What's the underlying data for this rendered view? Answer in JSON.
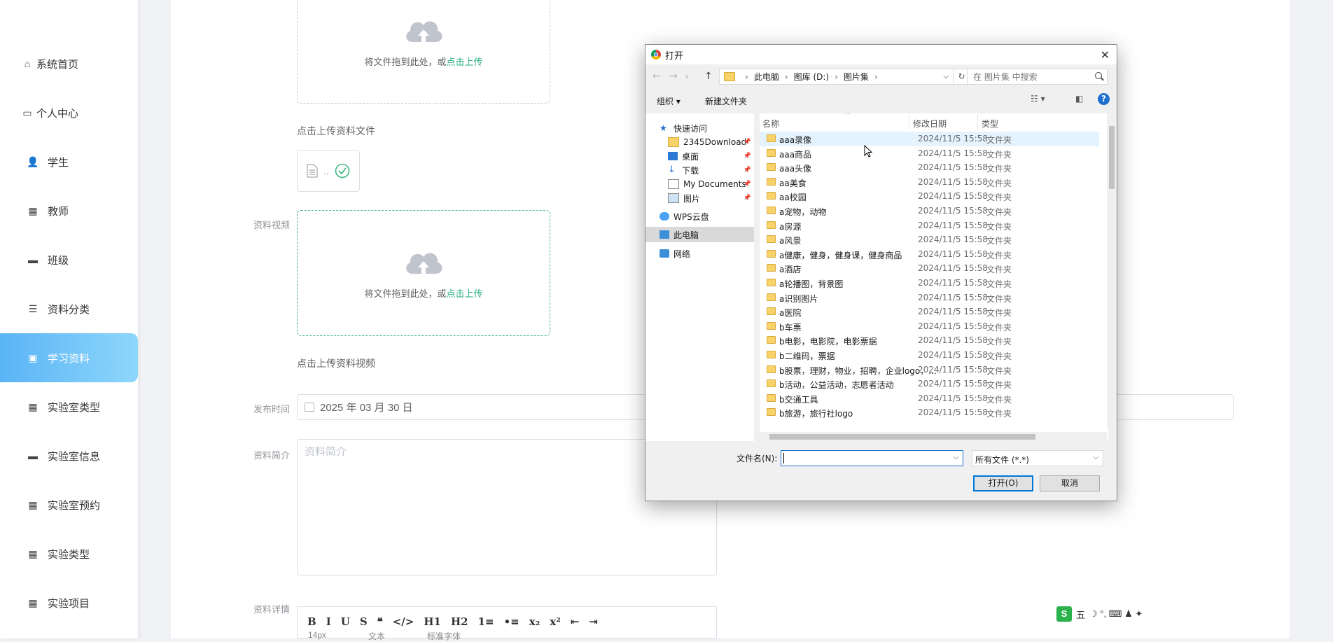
{
  "sidebar": {
    "items": [
      {
        "label": "系统首页",
        "icon": "home-icon"
      },
      {
        "label": "个人中心",
        "icon": "id-card-icon"
      },
      {
        "label": "学生",
        "icon": "user-icon"
      },
      {
        "label": "教师",
        "icon": "grid-icon"
      },
      {
        "label": "班级",
        "icon": "briefcase-icon"
      },
      {
        "label": "资料分类",
        "icon": "list-icon"
      },
      {
        "label": "学习资料",
        "icon": "clipboard-icon",
        "active": true
      },
      {
        "label": "实验室类型",
        "icon": "grid-icon"
      },
      {
        "label": "实验室信息",
        "icon": "monitor-icon"
      },
      {
        "label": "实验室预约",
        "icon": "grid-icon"
      },
      {
        "label": "实验类型",
        "icon": "grid-icon"
      },
      {
        "label": "实验项目",
        "icon": "grid-icon"
      }
    ]
  },
  "form": {
    "upload_drag_text": "将文件拖到此处，或",
    "upload_link": "点击上传",
    "file_tip": "点击上传资料文件",
    "file_thumb_text": "..",
    "video_label": "资料视频",
    "video_tip": "点击上传资料视频",
    "date_label": "发布时间",
    "date_value": "2025 年 03 月 30 日",
    "intro_label": "资料简介",
    "intro_placeholder": "资料简介",
    "detail_label": "资料详情",
    "editor_buttons": [
      "B",
      "I",
      "U",
      "S",
      "❝",
      "</>",
      "H1",
      "H2",
      "1≡",
      "•≡",
      "x₂",
      "x²",
      "⇤",
      "⇥"
    ],
    "editor_row2": [
      "14px",
      "文本",
      "标准字体"
    ]
  },
  "dialog": {
    "title": "打开",
    "path": [
      "此电脑",
      "图库 (D:)",
      "图片集"
    ],
    "search_placeholder": "在 图片集 中搜索",
    "organize": "组织 ▾",
    "new_folder": "新建文件夹",
    "columns": {
      "name": "名称",
      "date": "修改日期",
      "type": "类型"
    },
    "nav": [
      {
        "label": "快速访问",
        "icon": "star-icon"
      },
      {
        "label": "2345Download",
        "icon": "folder-icon",
        "pinned": true
      },
      {
        "label": "桌面",
        "icon": "desktop-icon",
        "pinned": true
      },
      {
        "label": "下载",
        "icon": "download-icon",
        "pinned": true
      },
      {
        "label": "My Documents",
        "icon": "document-icon",
        "pinned": true
      },
      {
        "label": "图片",
        "icon": "picture-icon",
        "pinned": true
      },
      {
        "label": "WPS云盘",
        "icon": "cloud-icon"
      },
      {
        "label": "此电脑",
        "icon": "computer-icon",
        "selected": true
      },
      {
        "label": "网络",
        "icon": "network-icon"
      }
    ],
    "files": [
      {
        "name": "aaa录像",
        "date": "2024/11/5 15:58",
        "type": "文件夹"
      },
      {
        "name": "aaa商品",
        "date": "2024/11/5 15:58",
        "type": "文件夹"
      },
      {
        "name": "aaa头像",
        "date": "2024/11/5 15:58",
        "type": "文件夹"
      },
      {
        "name": "aa美食",
        "date": "2024/11/5 15:58",
        "type": "文件夹"
      },
      {
        "name": "aa校园",
        "date": "2024/11/5 15:58",
        "type": "文件夹"
      },
      {
        "name": "a宠物，动物",
        "date": "2024/11/5 15:58",
        "type": "文件夹"
      },
      {
        "name": "a房源",
        "date": "2024/11/5 15:58",
        "type": "文件夹"
      },
      {
        "name": "a风景",
        "date": "2024/11/5 15:58",
        "type": "文件夹"
      },
      {
        "name": "a健康，健身，健身课，健身商品",
        "date": "2024/11/5 15:58",
        "type": "文件夹"
      },
      {
        "name": "a酒店",
        "date": "2024/11/5 15:58",
        "type": "文件夹"
      },
      {
        "name": "a轮播图，背景图",
        "date": "2024/11/5 15:58",
        "type": "文件夹"
      },
      {
        "name": "a识别图片",
        "date": "2024/11/5 15:58",
        "type": "文件夹"
      },
      {
        "name": "a医院",
        "date": "2024/11/5 15:58",
        "type": "文件夹"
      },
      {
        "name": "b车票",
        "date": "2024/11/5 15:58",
        "type": "文件夹"
      },
      {
        "name": "b电影，电影院，电影票据",
        "date": "2024/11/5 15:58",
        "type": "文件夹"
      },
      {
        "name": "b二维码，票据",
        "date": "2024/11/5 15:58",
        "type": "文件夹"
      },
      {
        "name": "b股票，理财，物业，招聘，企业logo，...",
        "date": "2024/11/5 15:58",
        "type": "文件夹"
      },
      {
        "name": "b活动，公益活动，志愿者活动",
        "date": "2024/11/5 15:58",
        "type": "文件夹"
      },
      {
        "name": "b交通工具",
        "date": "2024/11/5 15:58",
        "type": "文件夹"
      },
      {
        "name": "b旅游，旅行社logo",
        "date": "2024/11/5 15:58",
        "type": "文件夹"
      }
    ],
    "filename_label": "文件名(N):",
    "filename_value": "",
    "filetype_value": "所有文件 (*.*)",
    "open_label": "打开(O)",
    "cancel_label": "取消"
  },
  "ime": {
    "logo": "S",
    "mode": "五",
    "symbols": "☽ °, ⌨ ♟ ✦"
  }
}
